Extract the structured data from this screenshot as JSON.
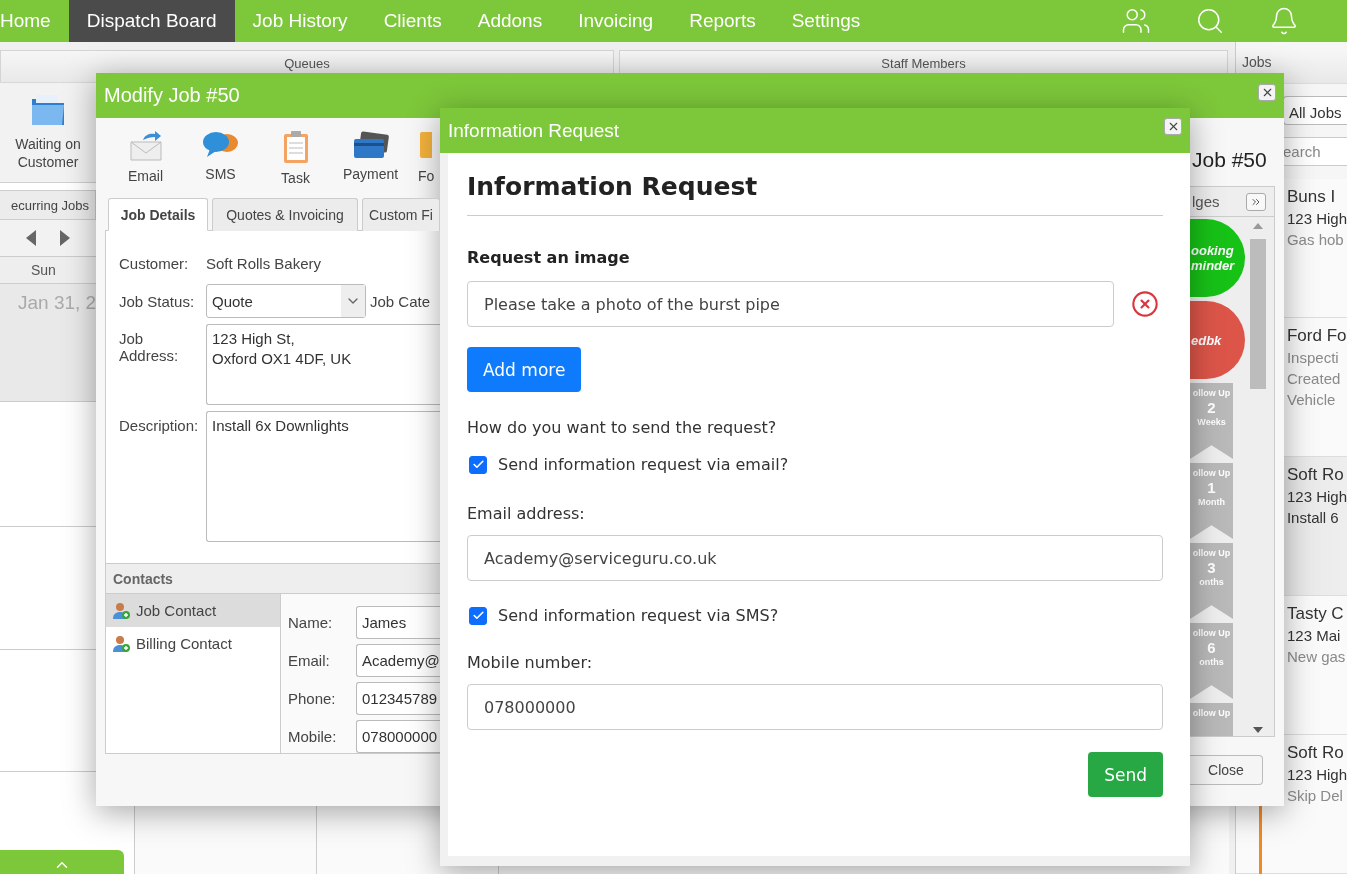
{
  "nav": {
    "items": [
      {
        "label": "Home",
        "selected": false
      },
      {
        "label": "Dispatch Board",
        "selected": true
      },
      {
        "label": "Job History",
        "selected": false
      },
      {
        "label": "Clients",
        "selected": false
      },
      {
        "label": "Addons",
        "selected": false
      },
      {
        "label": "Invoicing",
        "selected": false
      },
      {
        "label": "Reports",
        "selected": false
      },
      {
        "label": "Settings",
        "selected": false
      }
    ]
  },
  "queues": {
    "header": "Queues",
    "tile": "Waiting on Customer",
    "recurring_button": "ecurring Jobs",
    "day": "Sun",
    "date": "Jan 31, 2"
  },
  "staff": {
    "header": "Staff Members"
  },
  "jobs_panel": {
    "title": "Jobs",
    "filter": "All Jobs",
    "search": {
      "placeholder": "earch"
    },
    "cards": [
      {
        "selected": false,
        "lines": [
          {
            "text": "Buns I",
            "muted": false
          },
          {
            "text": "123 High",
            "muted": false
          },
          {
            "text": "Gas hob",
            "muted": true
          }
        ]
      },
      {
        "selected": false,
        "lines": [
          {
            "text": "Ford Fo",
            "muted": false
          },
          {
            "text": "Inspecti",
            "muted": true
          },
          {
            "text": "Created",
            "muted": true
          },
          {
            "text": "Vehicle",
            "muted": true
          }
        ]
      },
      {
        "selected": true,
        "lines": [
          {
            "text": "Soft Ro",
            "muted": false
          },
          {
            "text": "123 High",
            "muted": false
          },
          {
            "text": "Install 6",
            "muted": false
          }
        ]
      },
      {
        "selected": false,
        "lines": [
          {
            "text": "Tasty C",
            "muted": false
          },
          {
            "text": "123 Mai",
            "muted": false
          },
          {
            "text": "New gas",
            "muted": true
          }
        ]
      },
      {
        "selected": false,
        "lines": [
          {
            "text": "Soft Ro",
            "muted": false
          },
          {
            "text": "123 High",
            "muted": false
          },
          {
            "text": "Skip Del",
            "muted": true
          }
        ]
      }
    ]
  },
  "modify_job": {
    "title": "Modify Job #50",
    "heading": "Job #50",
    "toolbar": [
      {
        "kind": "email",
        "label": "Email"
      },
      {
        "kind": "sms",
        "label": "SMS"
      },
      {
        "kind": "task",
        "label": "Task"
      },
      {
        "kind": "payment",
        "label": "Payment"
      },
      {
        "kind": "form",
        "label": "Fo"
      }
    ],
    "tabs": [
      {
        "label": "Job Details",
        "selected": true
      },
      {
        "label": "Quotes & Invoicing",
        "selected": false
      },
      {
        "label": "Custom Fi",
        "selected": false
      }
    ],
    "form": {
      "customer_label": "Customer:",
      "customer": "Soft Rolls Bakery",
      "status_label": "Job Status:",
      "status": "Quote",
      "category_label": "Job Cate",
      "address_label": "Job Address:",
      "address": "123 High St,\nOxford OX1 4DF, UK",
      "description_label": "Description:",
      "description": "Install 6x Downlights"
    },
    "contacts": {
      "header": "Contacts",
      "items": [
        {
          "label": "Job Contact",
          "selected": true
        },
        {
          "label": "Billing Contact",
          "selected": false
        }
      ],
      "fields": [
        {
          "label": "Name:",
          "value": "James"
        },
        {
          "label": "Email:",
          "value": "Academy@"
        },
        {
          "label": "Phone:",
          "value": "012345789"
        },
        {
          "label": "Mobile:",
          "value": "078000000"
        }
      ]
    },
    "badges": {
      "header": "lges",
      "items": [
        {
          "kind": "circle",
          "color": "#17c217",
          "lines": [
            "ooking",
            "minder"
          ]
        },
        {
          "kind": "circle",
          "color": "#dd5549",
          "lines": [
            "edbk"
          ]
        },
        {
          "kind": "ribbon",
          "lines": [
            "ollow Up",
            "2",
            "Weeks"
          ]
        },
        {
          "kind": "ribbon",
          "lines": [
            "ollow Up",
            "1",
            "Month"
          ]
        },
        {
          "kind": "ribbon",
          "lines": [
            "ollow Up",
            "3",
            "onths"
          ]
        },
        {
          "kind": "ribbon",
          "lines": [
            "ollow Up",
            "6",
            "onths"
          ]
        },
        {
          "kind": "ribbon",
          "lines": [
            "ollow Up"
          ]
        }
      ]
    },
    "close_button": "Close"
  },
  "info_request": {
    "title": "Information Request",
    "heading": "Information Request",
    "image_label": "Request an image",
    "image_requests": [
      "Please take a photo of the burst pipe"
    ],
    "add_button": "Add more",
    "question": "How do you want to send the request?",
    "email_option": {
      "label": "Send information request via email?",
      "checked": true
    },
    "email_label": "Email address:",
    "email": "Academy@serviceguru.co.uk",
    "sms_option": {
      "label": "Send information request via SMS?",
      "checked": true
    },
    "mobile_label": "Mobile number:",
    "mobile": "078000000",
    "send_button": "Send"
  }
}
